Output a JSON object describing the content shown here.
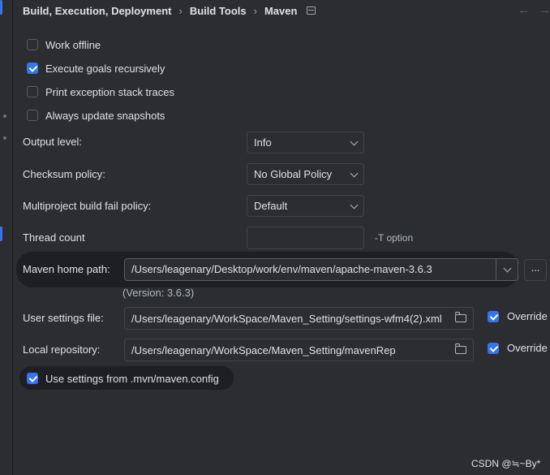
{
  "breadcrumb": {
    "items": [
      "Build, Execution, Deployment",
      "Build Tools",
      "Maven"
    ],
    "back_arrow": "←",
    "forward_arrow": "→"
  },
  "checkboxes": [
    {
      "label": "Work offline",
      "checked": false
    },
    {
      "label": "Execute goals recursively",
      "checked": true
    },
    {
      "label": "Print exception stack traces",
      "checked": false
    },
    {
      "label": "Always update snapshots",
      "checked": false
    }
  ],
  "settings": {
    "output_level": {
      "label": "Output level:",
      "value": "Info"
    },
    "checksum_policy": {
      "label": "Checksum policy:",
      "value": "No Global Policy"
    },
    "multiproject_fail_policy": {
      "label": "Multiproject build fail policy:",
      "value": "Default"
    },
    "thread_count": {
      "label": "Thread count",
      "value": "",
      "hint": "-T option"
    }
  },
  "maven_home": {
    "label": "Maven home path:",
    "value": "/Users/leagenary/Desktop/work/env/maven/apache-maven-3.6.3",
    "version": "(Version: 3.6.3)",
    "browse_label": "..."
  },
  "user_settings": {
    "label": "User settings file:",
    "value": "/Users/leagenary/WorkSpace/Maven_Setting/settings-wfm4(2).xml",
    "override_label": "Override",
    "override_checked": true
  },
  "local_repository": {
    "label": "Local repository:",
    "value": "/Users/leagenary/WorkSpace/Maven_Setting/mavenRep",
    "override_label": "Override",
    "override_checked": true
  },
  "mvn_config": {
    "label": "Use settings from .mvn/maven.config",
    "checked": true
  },
  "watermark": "CSDN @≒~By*",
  "colors": {
    "accent": "#3574f0",
    "background": "#2b2d30",
    "border": "#43454a",
    "text": "#dfe1e5"
  }
}
